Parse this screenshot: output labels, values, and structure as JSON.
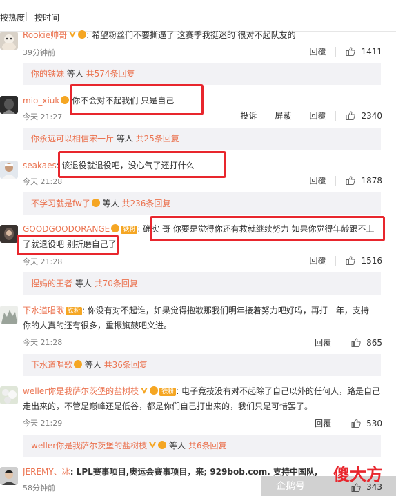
{
  "sort": {
    "hot": "按热度",
    "time": "按时间"
  },
  "comments": [
    {
      "user": "Rookie帅哥",
      "text": ": 希望粉丝们不要撕逼了 这赛季我挺迷的 很对不起队友的",
      "time": "39分钟前",
      "reply": "回覆",
      "likes": "1411",
      "sub_user": "你的铁妹",
      "sub_mid": " 等人 ",
      "sub_count": "共574条回复"
    },
    {
      "user": "mio_xiuk",
      "text": ":你不会对不起我们 只是自己",
      "time": "今天 21:27",
      "report": "投诉",
      "block": "屏蔽",
      "reply": "回覆",
      "likes": "2340",
      "sub_user": "你永远可以相信宋一斤",
      "sub_mid": " 等人 ",
      "sub_count": "共25条回复"
    },
    {
      "user": "seakaes",
      "text": ": 该退役就退役吧，没心气了还打什么",
      "time": "今天 21:28",
      "reply": "回覆",
      "likes": "1878",
      "sub_user": "不学习就是fw了",
      "sub_mid": " 等人 ",
      "sub_count": "共236条回复"
    },
    {
      "user": "GOODGOODORANGE",
      "badge": "铁粉",
      "text1": ": 确实 哥 你要是觉得你还有救就继续努力 如果你觉得年龄跟不上",
      "text2": "了就退役吧 别折磨自己了",
      "time": "今天 21:28",
      "reply": "回覆",
      "likes": "1516",
      "sub_user": "捏妈的王者",
      "sub_mid": " 等人 ",
      "sub_count": "共70条回复"
    },
    {
      "user": "下水道唱歌",
      "badge": "铁粉",
      "text1": ": 你没有对不起谁，如果觉得抱歉那我们明年接着努力吧好吗，再打一年，支持",
      "text2": "你的人真的还有很多，重振旗鼓吧义进。",
      "time": "今天 21:28",
      "reply": "回覆",
      "likes": "865",
      "sub_user": "下水道唱歌",
      "sub_mid": " 等人 ",
      "sub_count": "共36条回复"
    },
    {
      "user": "weller你是我萨尔茨堡的盐树枝",
      "badge": "铁粉",
      "text1": ": 电子竞技没有对不起除了自己以外的任何人，路是自己",
      "text2": "走出来的，不管是巅峰还是低谷，都是你们自己打出来的，我们只是可惜罢了。",
      "time": "今天 21:29",
      "reply": "回覆",
      "likes": "530",
      "sub_user": "weller你是我萨尔茨堡的盐树枝",
      "sub_mid": " 等人 ",
      "sub_count": "共6条回复"
    },
    {
      "user": "JEREMY、冰",
      "text": ": LPL赛事项目,奥运会赛事项目，来; 929bob.com. 支持中国队, 拿",
      "time": "58分钟前",
      "likes": "343"
    }
  ],
  "watermark": {
    "brand": "企鹅号",
    "logo": "傻大方"
  }
}
